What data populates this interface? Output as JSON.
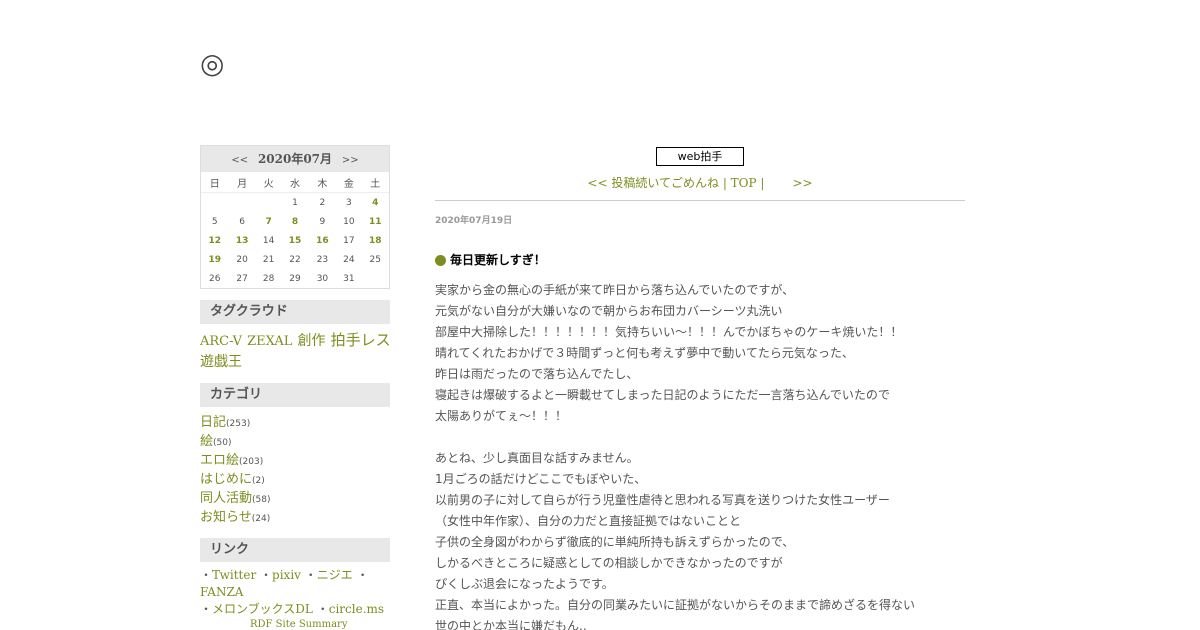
{
  "site": {
    "title": "◎"
  },
  "calendar": {
    "prev": "<<",
    "month": "2020年07月",
    "next": ">>",
    "weekdays": [
      "日",
      "月",
      "火",
      "水",
      "木",
      "金",
      "土"
    ],
    "weeks": [
      [
        "",
        "",
        "",
        "1",
        "2",
        "3",
        "4"
      ],
      [
        "5",
        "6",
        "7",
        "8",
        "9",
        "10",
        "11"
      ],
      [
        "12",
        "13",
        "14",
        "15",
        "16",
        "17",
        "18"
      ],
      [
        "19",
        "20",
        "21",
        "22",
        "23",
        "24",
        "25"
      ],
      [
        "26",
        "27",
        "28",
        "29",
        "30",
        "31",
        ""
      ]
    ],
    "linked_days": [
      "4",
      "7",
      "8",
      "11",
      "12",
      "13",
      "15",
      "16",
      "18",
      "19"
    ]
  },
  "tagcloud": {
    "heading": "タグクラウド",
    "tags": [
      {
        "label": "ARC-V",
        "size": "s"
      },
      {
        "label": "ZEXAL",
        "size": "s"
      },
      {
        "label": "創作",
        "size": "m"
      },
      {
        "label": "拍手レス",
        "size": "l"
      },
      {
        "label": "遊戯王",
        "size": "m"
      }
    ]
  },
  "categories": {
    "heading": "カテゴリ",
    "items": [
      {
        "label": "日記",
        "count": "(253)"
      },
      {
        "label": "絵",
        "count": "(50)"
      },
      {
        "label": "エロ絵",
        "count": "(203)"
      },
      {
        "label": "はじめに",
        "count": "(2)"
      },
      {
        "label": "同人活動",
        "count": "(58)"
      },
      {
        "label": "お知らせ",
        "count": "(24)"
      }
    ]
  },
  "links": {
    "heading": "リンク",
    "items": [
      "Twitter",
      "pixiv",
      "ニジエ",
      "FANZA",
      "メロンブックスDL",
      "circle.ms"
    ],
    "bullet": "・"
  },
  "rdf": {
    "label": "RDF Site Summary"
  },
  "main": {
    "clap_label": "web拍手",
    "nav_prev": "<< 投稿続いてごめんね",
    "nav_sep": " | ",
    "nav_top": "TOP",
    "nav_sep2": " |",
    "nav_next": ">>",
    "date": "2020年07月19日",
    "entry_title": "毎日更新しすぎ！",
    "body": [
      "実家から金の無心の手紙が来て昨日から落ち込んでいたのですが、",
      "元気がない自分が大嫌いなので朝からお布団カバーシーツ丸洗い",
      "部屋中大掃除した！！！！！！！気持ちいい～！！！んでかぼちゃのケーキ焼いた！！",
      "晴れてくれたおかげで３時間ずっと何も考えず夢中で動いてたら元気なった、",
      "昨日は雨だったので落ち込んでたし、",
      "寝起きは爆破するよと一瞬載せてしまった日記のようにただ一言落ち込んでいたので",
      "太陽ありがてぇ～！！！",
      "",
      "あとね、少し真面目な話すみません。",
      "1月ごろの話だけどここでもぼやいた、",
      "以前男の子に対して自らが行う児童性虐待と思われる写真を送りつけた女性ユーザー",
      "（女性中年作家）、自分の力だと直接証拠ではないことと",
      "子供の全身図がわからず徹底的に単純所持も訴えずらかったので、",
      "しかるべきところに疑惑としての相談しかできなかったのですが",
      "ぴくしぶ退会になったようです。",
      "正直、本当によかった。自分の同業みたいに証拠がないからそのままで諦めざるを得ない",
      "世の中とか本当に嫌だもん.."
    ]
  }
}
